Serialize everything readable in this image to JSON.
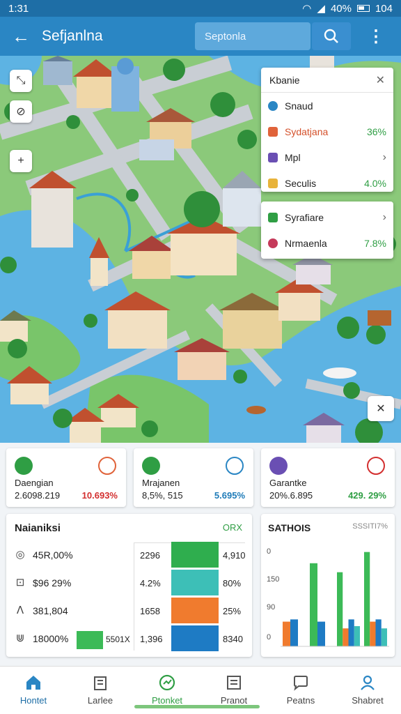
{
  "status": {
    "time": "1:31",
    "battery": "40%",
    "extra": "104"
  },
  "app_bar": {
    "title": "Sefjanlna",
    "search_placeholder": "Septonla"
  },
  "layers": {
    "header": "Kbanie",
    "group1": [
      {
        "label": "Snaud",
        "value": "",
        "color": "#2a86c4",
        "icon": "snowflake-icon"
      },
      {
        "label": "Sydatjana",
        "value": "36%",
        "color": "#e0633a",
        "icon": "layer-icon"
      },
      {
        "label": "Mpl",
        "value": "",
        "color": "#6a4fb3",
        "icon": "map-pin-icon",
        "chevron": true
      },
      {
        "label": "Seculis",
        "value": "4.0%",
        "color": "#e8b33a",
        "icon": "layer-icon"
      }
    ],
    "group2": [
      {
        "label": "Syrafiare",
        "value": "",
        "color": "#2f9e44",
        "icon": "leaf-icon",
        "chevron": true
      },
      {
        "label": "Nrmaenla",
        "value": "7.8%",
        "color": "#c53a5a",
        "icon": "dots-icon"
      }
    ]
  },
  "stat_cards": [
    {
      "name": "Daengian",
      "number": "2.6098.219",
      "percent": "10.693%",
      "percent_color": "#d32f2f",
      "icon_left_color": "#2f9e44",
      "icon_right_color": "#e0633a"
    },
    {
      "name": "Mrajanen",
      "number": "8,5%, 515",
      "percent": "5.695%",
      "percent_color": "#1e7bb8",
      "icon_left_color": "#2f9e44",
      "icon_right_color": "#2a86c4"
    },
    {
      "name": "Garantke",
      "number": "20%.6.895",
      "percent": "429. 29%",
      "percent_color": "#2f9e44",
      "icon_left_color": "#6a4fb3",
      "icon_right_color": "#d32f2f"
    }
  ],
  "table_panel": {
    "title": "Naianiksi",
    "action": "ORX",
    "rows": [
      {
        "icon": "◎",
        "left": "45R,00%",
        "mid": "2296",
        "bar_color": "#2fae4e",
        "right": "4,910"
      },
      {
        "icon": "⊡",
        "left": "$96 29%",
        "mid": "4.2%",
        "bar_color": "#3dbfb7",
        "right": "80%"
      },
      {
        "icon": "ⴷ",
        "left": "381,804",
        "mid": "1658",
        "bar_color": "#f07b2e",
        "right": "25%"
      },
      {
        "icon": "⋓",
        "left": "18000%",
        "mid": "1,396",
        "bar_color": "#1e7bc4",
        "right": "8340",
        "extra_bar": "#3cba57",
        "extra_text": "5501X"
      }
    ]
  },
  "chart_panel": {
    "title": "SATHOIS",
    "subtitle": "SSSITI7%",
    "chart_data": {
      "type": "bar",
      "ytick_labels": [
        "0",
        "150",
        "90",
        "0"
      ],
      "series": [
        {
          "name": "",
          "color": "#3cba57",
          "values": [
            0,
            37,
            33,
            42
          ]
        },
        {
          "name": "",
          "color": "#f07b2e",
          "values": [
            11,
            0,
            8,
            11
          ]
        },
        {
          "name": "",
          "color": "#1e7bc4",
          "values": [
            12,
            11,
            12,
            12
          ]
        },
        {
          "name": "",
          "color": "#3dbfb7",
          "values": [
            0,
            0,
            9,
            8
          ]
        }
      ]
    }
  },
  "bottom_nav": [
    {
      "label": "Hontet",
      "icon": "home-icon",
      "active": true
    },
    {
      "label": "Larlee",
      "icon": "building-icon",
      "active": false
    },
    {
      "label": "Ptonket",
      "icon": "map-marker-icon",
      "active": false
    },
    {
      "label": "Pranot",
      "icon": "list-icon",
      "active": false
    },
    {
      "label": "Peatns",
      "icon": "chat-icon",
      "active": false
    },
    {
      "label": "Shabret",
      "icon": "person-icon",
      "active": false
    }
  ],
  "colors": {
    "primary": "#2a86c4",
    "primary_dark": "#1e6ea6",
    "green": "#2f9e44",
    "water": "#5db3e3"
  }
}
